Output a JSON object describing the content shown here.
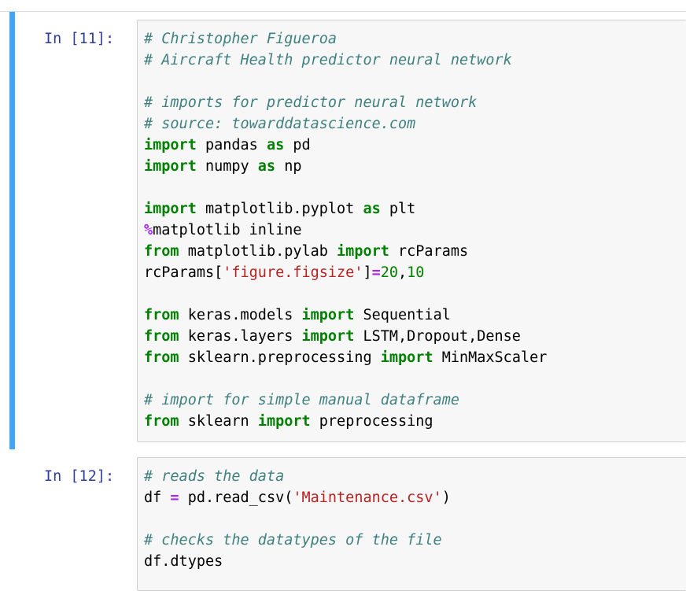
{
  "cells": [
    {
      "prompt": "In [11]:",
      "lines": [
        [
          {
            "t": "# Christopher Figueroa",
            "c": "comment"
          }
        ],
        [
          {
            "t": "# Aircraft Health predictor neural network",
            "c": "comment"
          }
        ],
        [],
        [
          {
            "t": "# imports for predictor neural network",
            "c": "comment"
          }
        ],
        [
          {
            "t": "# source: towarddatascience.com",
            "c": "comment"
          }
        ],
        [
          {
            "t": "import",
            "c": "kw"
          },
          {
            "t": " pandas ",
            "c": "name"
          },
          {
            "t": "as",
            "c": "kw"
          },
          {
            "t": " pd",
            "c": "name"
          }
        ],
        [
          {
            "t": "import",
            "c": "kw"
          },
          {
            "t": " numpy ",
            "c": "name"
          },
          {
            "t": "as",
            "c": "kw"
          },
          {
            "t": " np",
            "c": "name"
          }
        ],
        [],
        [
          {
            "t": "import",
            "c": "kw"
          },
          {
            "t": " matplotlib.pyplot ",
            "c": "name"
          },
          {
            "t": "as",
            "c": "kw"
          },
          {
            "t": " plt",
            "c": "name"
          }
        ],
        [
          {
            "t": "%",
            "c": "op"
          },
          {
            "t": "matplotlib inline",
            "c": "name"
          }
        ],
        [
          {
            "t": "from",
            "c": "kw"
          },
          {
            "t": " matplotlib.pylab ",
            "c": "name"
          },
          {
            "t": "import",
            "c": "kw"
          },
          {
            "t": " rcParams",
            "c": "name"
          }
        ],
        [
          {
            "t": "rcParams[",
            "c": "name"
          },
          {
            "t": "'figure.figsize'",
            "c": "str"
          },
          {
            "t": "]",
            "c": "name"
          },
          {
            "t": "=",
            "c": "op"
          },
          {
            "t": "20",
            "c": "num"
          },
          {
            "t": ",",
            "c": "name"
          },
          {
            "t": "10",
            "c": "num"
          }
        ],
        [],
        [
          {
            "t": "from",
            "c": "kw"
          },
          {
            "t": " keras.models ",
            "c": "name"
          },
          {
            "t": "import",
            "c": "kw"
          },
          {
            "t": " Sequential",
            "c": "name"
          }
        ],
        [
          {
            "t": "from",
            "c": "kw"
          },
          {
            "t": " keras.layers ",
            "c": "name"
          },
          {
            "t": "import",
            "c": "kw"
          },
          {
            "t": " LSTM,Dropout,Dense",
            "c": "name"
          }
        ],
        [
          {
            "t": "from",
            "c": "kw"
          },
          {
            "t": " sklearn.preprocessing ",
            "c": "name"
          },
          {
            "t": "import",
            "c": "kw"
          },
          {
            "t": " MinMaxScaler",
            "c": "name"
          }
        ],
        [],
        [
          {
            "t": "# import for simple manual dataframe",
            "c": "comment"
          }
        ],
        [
          {
            "t": "from",
            "c": "kw"
          },
          {
            "t": " sklearn ",
            "c": "name"
          },
          {
            "t": "import",
            "c": "kw"
          },
          {
            "t": " preprocessing",
            "c": "name"
          }
        ]
      ]
    },
    {
      "prompt": "In [12]:",
      "lines": [
        [
          {
            "t": "# reads the data",
            "c": "comment"
          }
        ],
        [
          {
            "t": "df ",
            "c": "name"
          },
          {
            "t": "=",
            "c": "op"
          },
          {
            "t": " pd.read_csv(",
            "c": "name"
          },
          {
            "t": "'Maintenance.csv'",
            "c": "str"
          },
          {
            "t": ")",
            "c": "name"
          }
        ],
        [],
        [
          {
            "t": "# checks the datatypes of the file",
            "c": "comment"
          }
        ],
        [
          {
            "t": "df.dtypes",
            "c": "name"
          }
        ]
      ]
    }
  ],
  "colors": {
    "selected_bar": "#42a5f5",
    "prompt": "#303f9f",
    "comment": "#408080",
    "keyword": "#008000",
    "string": "#ba2121",
    "operator": "#aa22ff",
    "input_bg": "#f7f7f7"
  }
}
